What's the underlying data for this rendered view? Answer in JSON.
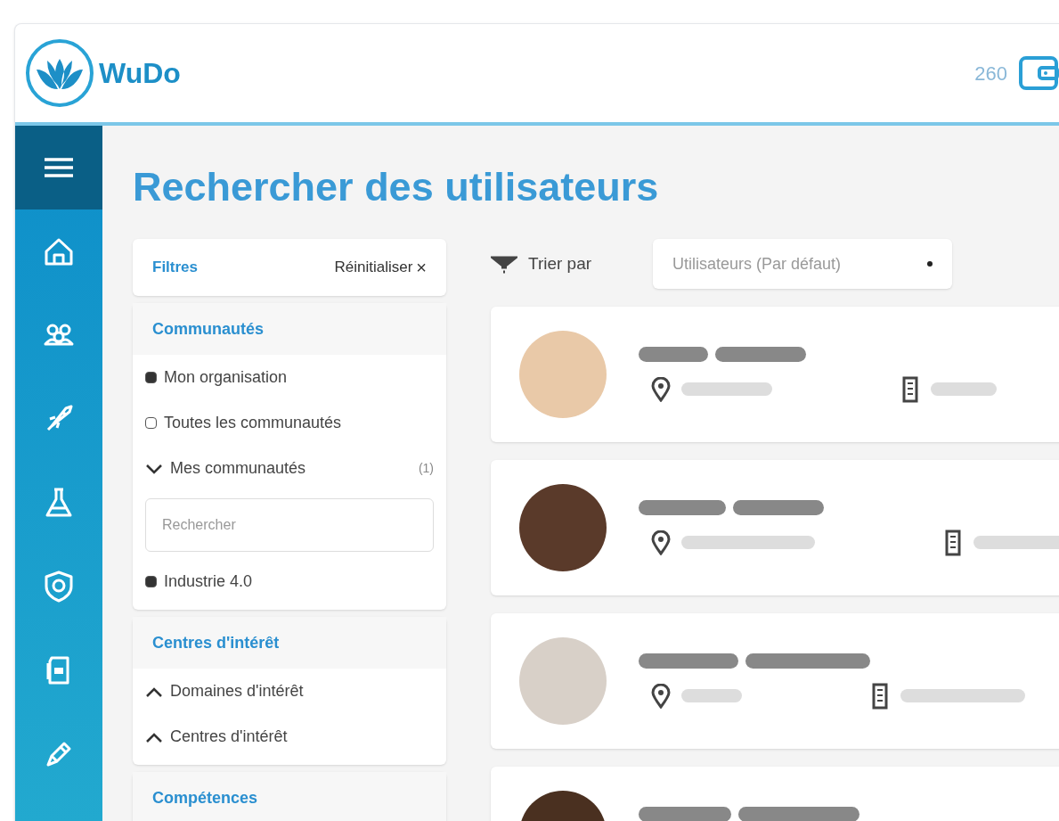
{
  "header": {
    "logo_text": "WuDo",
    "credits": "260"
  },
  "page_title": "Rechercher des utilisateurs",
  "filters": {
    "title": "Filtres",
    "reset": "Réinitialiser",
    "reset_icon": "×",
    "sections": [
      {
        "title": "Communautés",
        "items": [
          {
            "kind": "checkbox",
            "label": "Mon organisation",
            "checked": true
          },
          {
            "kind": "checkbox",
            "label": "Toutes les communautés",
            "checked": false
          },
          {
            "kind": "group",
            "label": "Mes communautés",
            "count": "(1)",
            "expanded": true
          },
          {
            "kind": "search",
            "placeholder": "Rechercher"
          },
          {
            "kind": "checkbox",
            "label": "Industrie 4.0",
            "checked": true
          }
        ]
      },
      {
        "title": "Centres d'intérêt",
        "items": [
          {
            "kind": "group",
            "label": "Domaines d'intérêt",
            "expanded": false
          },
          {
            "kind": "group",
            "label": "Centres d'intérêt",
            "expanded": false
          }
        ]
      },
      {
        "title": "Compétences"
      }
    ]
  },
  "sort": {
    "label": "Trier par",
    "value": "Utilisateurs (Par défaut)"
  }
}
